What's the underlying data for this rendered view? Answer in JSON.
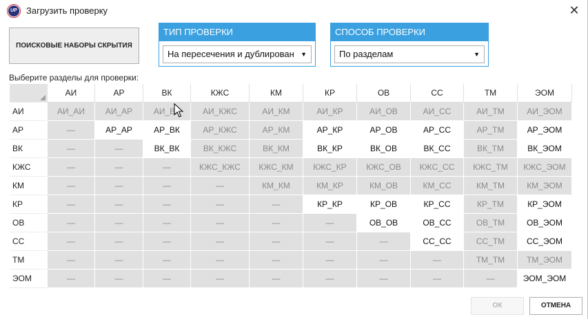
{
  "window": {
    "title": "Загрузить проверку",
    "icon_text": "UP"
  },
  "buttons": {
    "search_sets": "ПОИСКОВЫЕ НАБОРЫ СКРЫТИЯ",
    "ok": "ОК",
    "cancel": "ОТМЕНА"
  },
  "check_type": {
    "header": "ТИП ПРОВЕРКИ",
    "selected": "На пересечения и дублирован"
  },
  "check_method": {
    "header": "СПОСОБ ПРОВЕРКИ",
    "selected": "По разделам"
  },
  "hint": "Выберите разделы для проверки:",
  "matrix": {
    "columns": [
      "АИ",
      "АР",
      "ВК",
      "КЖС",
      "КМ",
      "КР",
      "ОВ",
      "СС",
      "ТМ",
      "ЭОМ"
    ],
    "rows": [
      {
        "label": "АИ",
        "cells": [
          "АИ_АИ",
          "АИ_АР",
          "АИ_ВК",
          "АИ_КЖС",
          "АИ_КМ",
          "АИ_КР",
          "АИ_ОВ",
          "АИ_СС",
          "АИ_ТМ",
          "АИ_ЭОМ"
        ]
      },
      {
        "label": "АР",
        "cells": [
          "—",
          "АР_АР",
          "АР_ВК",
          "АР_КЖС",
          "АР_КМ",
          "АР_КР",
          "АР_ОВ",
          "АР_СС",
          "АР_ТМ",
          "АР_ЭОМ"
        ]
      },
      {
        "label": "ВК",
        "cells": [
          "—",
          "—",
          "ВК_ВК",
          "ВК_КЖС",
          "ВК_КМ",
          "ВК_КР",
          "ВК_ОВ",
          "ВК_СС",
          "ВК_ТМ",
          "ВК_ЭОМ"
        ]
      },
      {
        "label": "КЖС",
        "cells": [
          "—",
          "—",
          "—",
          "КЖС_КЖС",
          "КЖС_КМ",
          "КЖС_КР",
          "КЖС_ОВ",
          "КЖС_СС",
          "КЖС_ТМ",
          "КЖС_ЭОМ"
        ]
      },
      {
        "label": "КМ",
        "cells": [
          "—",
          "—",
          "—",
          "—",
          "КМ_КМ",
          "КМ_КР",
          "КМ_ОВ",
          "КМ_СС",
          "КМ_ТМ",
          "КМ_ЭОМ"
        ]
      },
      {
        "label": "КР",
        "cells": [
          "—",
          "—",
          "—",
          "—",
          "—",
          "КР_КР",
          "КР_ОВ",
          "КР_СС",
          "КР_ТМ",
          "КР_ЭОМ"
        ]
      },
      {
        "label": "ОВ",
        "cells": [
          "—",
          "—",
          "—",
          "—",
          "—",
          "—",
          "ОВ_ОВ",
          "ОВ_СС",
          "ОВ_ТМ",
          "ОВ_ЭОМ"
        ]
      },
      {
        "label": "СС",
        "cells": [
          "—",
          "—",
          "—",
          "—",
          "—",
          "—",
          "—",
          "СС_СС",
          "СС_ТМ",
          "СС_ЭОМ"
        ]
      },
      {
        "label": "ТМ",
        "cells": [
          "—",
          "—",
          "—",
          "—",
          "—",
          "—",
          "—",
          "—",
          "ТМ_ТМ",
          "ТМ_ЭОМ"
        ]
      },
      {
        "label": "ЭОМ",
        "cells": [
          "—",
          "—",
          "—",
          "—",
          "—",
          "—",
          "—",
          "—",
          "—",
          "ЭОМ_ЭОМ"
        ]
      }
    ],
    "disabled": [
      [
        1,
        1,
        1,
        1,
        1,
        1,
        1,
        1,
        1,
        1
      ],
      [
        1,
        0,
        0,
        1,
        1,
        0,
        0,
        0,
        1,
        0
      ],
      [
        1,
        1,
        0,
        1,
        1,
        0,
        0,
        0,
        1,
        0
      ],
      [
        1,
        1,
        1,
        1,
        1,
        1,
        1,
        1,
        1,
        1
      ],
      [
        1,
        1,
        1,
        1,
        1,
        1,
        1,
        1,
        1,
        1
      ],
      [
        1,
        1,
        1,
        1,
        1,
        0,
        0,
        0,
        1,
        0
      ],
      [
        1,
        1,
        1,
        1,
        1,
        1,
        0,
        0,
        1,
        0
      ],
      [
        1,
        1,
        1,
        1,
        1,
        1,
        1,
        0,
        1,
        0
      ],
      [
        1,
        1,
        1,
        1,
        1,
        1,
        1,
        1,
        1,
        1
      ],
      [
        1,
        1,
        1,
        1,
        1,
        1,
        1,
        1,
        1,
        0
      ]
    ]
  },
  "colors": {
    "accent": "#3aa0e0",
    "disabled_cell": "#e0e0e0",
    "disabled_text": "#8a8a8a"
  },
  "icons": {
    "close": "close-icon",
    "dropdown": "chevron-down-icon",
    "app": "app-logo-icon"
  }
}
